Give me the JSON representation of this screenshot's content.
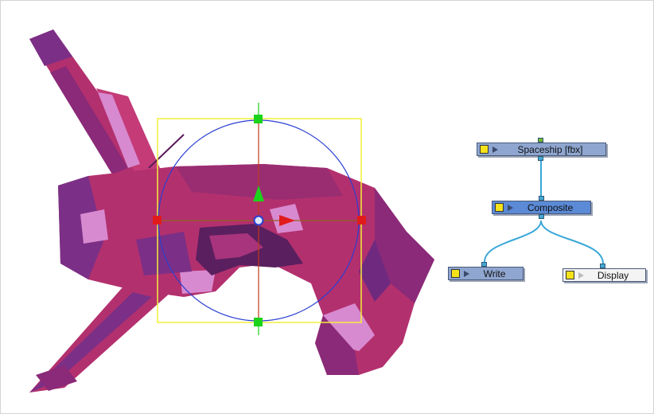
{
  "nodes": {
    "spaceship": {
      "label": "Spaceship  [fbx]",
      "icon": "play-icon"
    },
    "composite": {
      "label": "Composite",
      "icon": "play-icon"
    },
    "write": {
      "label": "Write",
      "icon": "play-icon"
    },
    "display": {
      "label": "Display",
      "icon": "play-icon"
    }
  },
  "colors": {
    "node_blue": "#8fa6d0",
    "node_selected": "#5b8ad6",
    "node_display": "#f4f4f4",
    "wire": "#3aa8d8",
    "port_in": "#79b62e",
    "port_out": "#47a7d2",
    "manip_circle": "#2b3fcf",
    "manip_box": "#f2ef3a",
    "axis_red": "#e11b1b",
    "axis_green": "#1cd31c",
    "ship_magenta": "#b3306e",
    "ship_purple": "#7c2f86",
    "ship_pink": "#d88ad0"
  }
}
